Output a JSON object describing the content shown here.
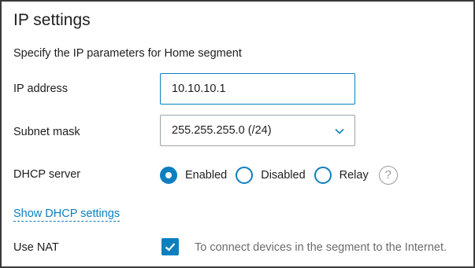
{
  "panel": {
    "title": "IP settings",
    "subtitle": "Specify the IP parameters for Home segment"
  },
  "ip_address": {
    "label": "IP address",
    "value": "10.10.10.1"
  },
  "subnet_mask": {
    "label": "Subnet mask",
    "selected": "255.255.255.0 (/24)",
    "icon": "chevron-down-icon"
  },
  "dhcp_server": {
    "label": "DHCP server",
    "options": [
      {
        "label": "Enabled",
        "checked": true
      },
      {
        "label": "Disabled",
        "checked": false
      },
      {
        "label": "Relay",
        "checked": false
      }
    ],
    "help_icon": "question-mark-icon",
    "help_glyph": "?"
  },
  "dhcp_link": {
    "label": "Show DHCP settings"
  },
  "nat": {
    "label": "Use NAT",
    "checked": true,
    "hint": "To connect devices in the segment to the Internet."
  },
  "colors": {
    "accent": "#0d7fbf",
    "text": "#1e1e1e",
    "muted": "#6b6b6b",
    "border": "#3a3a3a"
  }
}
